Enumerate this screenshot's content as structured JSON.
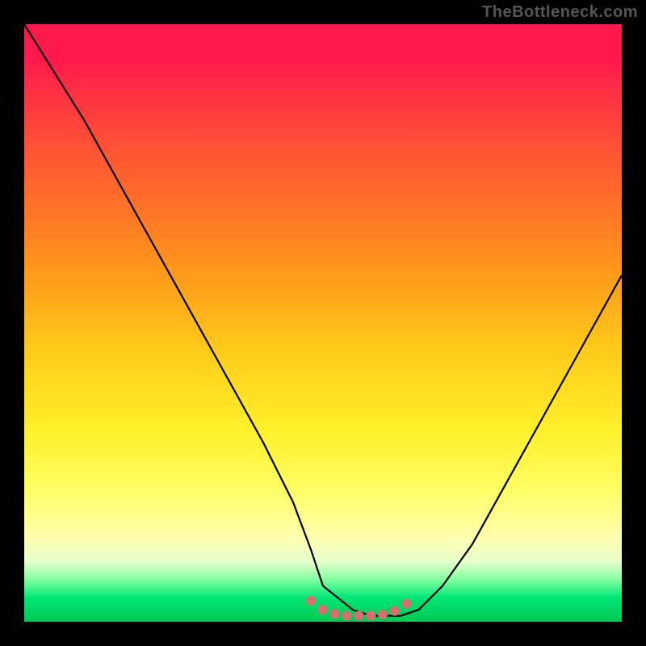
{
  "watermark": "TheBottleneck.com",
  "colors": {
    "frame_bg": "#000000",
    "watermark_text": "#555555",
    "curve": "#000000",
    "dots": "#d86e6e",
    "gradient_top": "#ff1a4d",
    "gradient_bottom": "#00c853"
  },
  "chart_data": {
    "type": "line",
    "title": "",
    "xlabel": "",
    "ylabel": "",
    "xlim": [
      0,
      100
    ],
    "ylim": [
      0,
      100
    ],
    "grid": false,
    "series": [
      {
        "name": "bottleneck-curve",
        "x": [
          0,
          5,
          10,
          15,
          20,
          25,
          30,
          35,
          40,
          45,
          48,
          50,
          55,
          58,
          60,
          63,
          66,
          70,
          75,
          80,
          85,
          90,
          95,
          100
        ],
        "values": [
          100,
          92,
          84,
          75,
          66,
          57,
          48,
          39,
          30,
          20,
          12,
          6,
          2,
          1,
          1,
          1,
          2,
          6,
          13,
          22,
          31,
          40,
          49,
          58
        ]
      }
    ],
    "valley_dots": {
      "name": "valley-markers",
      "x": [
        48,
        50,
        52,
        54,
        56,
        58,
        60,
        62,
        64
      ],
      "values": [
        3.5,
        2,
        1.3,
        1,
        1,
        1,
        1.2,
        1.8,
        3
      ]
    }
  }
}
